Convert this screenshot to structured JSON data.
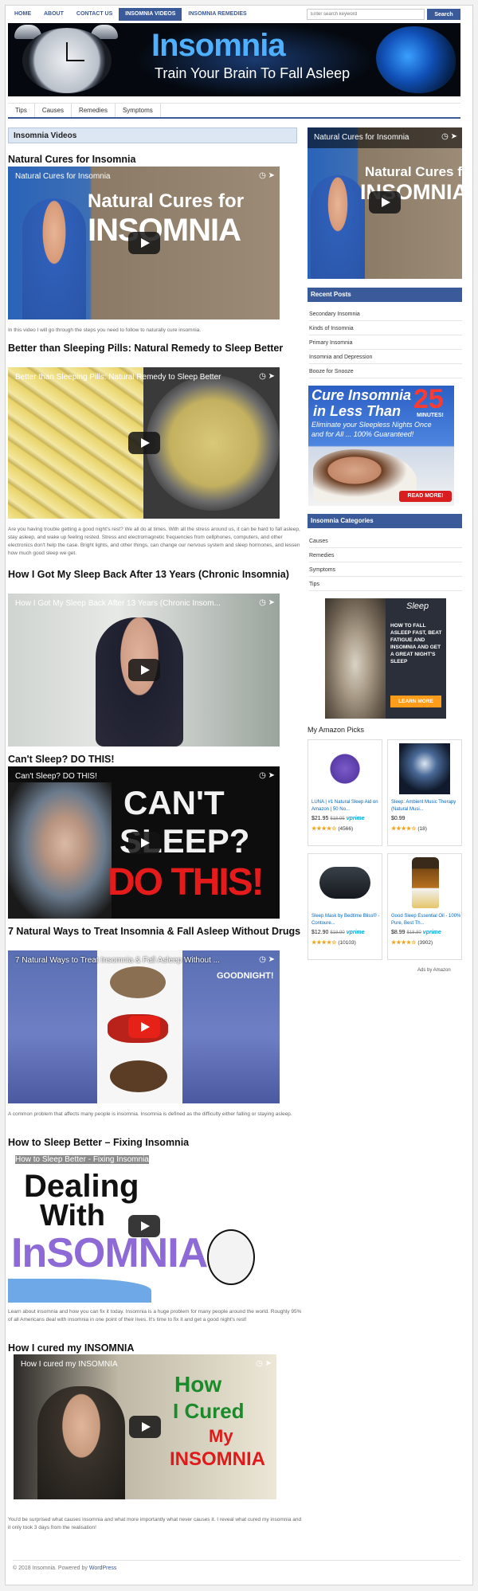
{
  "topnav": {
    "items": [
      "HOME",
      "ABOUT",
      "CONTACT US",
      "INSOMNIA VIDEOS",
      "INSOMNIA REMEDIES"
    ],
    "search_placeholder": "Enter search keyword",
    "search_button": "Search"
  },
  "header": {
    "title": "Insomnia",
    "tagline": "Train Your Brain To Fall Asleep"
  },
  "subnav": {
    "items": [
      "Tips",
      "Causes",
      "Remedies",
      "Symptoms"
    ]
  },
  "main": {
    "box_title": "Insomnia Videos",
    "posts": [
      {
        "title": "Natural Cures for Insomnia",
        "video_title": "Natural Cures for Insomnia",
        "art_line1": "Natural Cures for",
        "art_line2": "INSOMNIA",
        "text": "In this video I will go through the steps you need to follow to naturally cure insomnia."
      },
      {
        "title": "Better than Sleeping Pills: Natural Remedy to Sleep Better",
        "video_title": "Better than Sleeping Pills: Natural Remedy to Sleep Better",
        "text": "Are you having trouble getting a good night's rest? We all do at times. With all the stress around us, it can be hard to fall asleep, stay asleep, and wake up feeling rested. Stress and electromagnetic frequencies from cellphones, computers, and other electronics don't help the case. Bright lights, and other things, can change our nervous system and sleep hormones, and lessen how much good sleep we get."
      },
      {
        "title": "How I Got My Sleep Back After 13 Years (Chronic Insomnia)",
        "video_title": "How I Got My Sleep Back After 13 Years (Chronic Insom..."
      },
      {
        "title": "Can't Sleep? DO THIS!",
        "video_title": "Can't Sleep? DO THIS!",
        "art_line1": "CAN'T",
        "art_line2": "SLEEP?",
        "art_line3": "DO THIS!"
      },
      {
        "title": "7 Natural Ways to Treat Insomnia & Fall Asleep Without Drugs",
        "video_title": "7 Natural Ways to Treat Insomnia & Fall Asleep Without ...",
        "art_line1": "GOODNIGHT!",
        "text": "A common problem that affects many people is insomnia. Insomnia is defined as the difficulty either falling or staying asleep."
      },
      {
        "title": "How to Sleep Better – Fixing Insomnia",
        "video_title": "How to Sleep Better - Fixing Insomnia",
        "art_line1": "Dealing",
        "art_line2": "With",
        "art_line3": "InSOMNIA",
        "text": "Learn about insomnia and how you can fix it today. Insomnia is a huge problem for many people around the world. Roughly 95% of all Americans deal with insomnia in one point of their lives. It's time to fix it and get a good night's rest!"
      },
      {
        "title": "How I cured my INSOMNIA",
        "video_title": "How I cured my INSOMNIA",
        "art_line1": "How",
        "art_line2": "I Cured",
        "art_line3": "My",
        "art_line4": "INSOMNIA",
        "text": "You'd be surprised what causes insomnia and what more importantly what never causes it. I reveal what cured my insomnia and it only took 3 days from the realisation!"
      }
    ]
  },
  "sidebar": {
    "video_title": "Natural Cures for Insomnia",
    "video_art_line1": "Natural Cures fo",
    "video_art_line2": "INSOMNIA",
    "recent_posts_title": "Recent Posts",
    "recent_posts": [
      "Secondary Insomnia",
      "Kinds of Insomnia",
      "Primary Insomnia",
      "Insomnia and Depression",
      "Booze for Snooze"
    ],
    "ad1": {
      "line1": "Cure Insomnia",
      "line2": "in Less Than",
      "big": "25",
      "minutes": "MINUTES!",
      "line3": "Eliminate your Sleepless Nights Once",
      "line4": "and for All ... 100% Guaranteed!",
      "button": "READ MORE!"
    },
    "categories_title": "Insomnia Categories",
    "categories": [
      "Causes",
      "Remedies",
      "Symptoms",
      "Tips"
    ],
    "ad2": {
      "brand": "Sleep",
      "text": "HOW TO FALL ASLEEP FAST, BEAT FATIGUE AND INSOMNIA AND GET A GREAT NIGHT'S SLEEP",
      "button": "LEARN MORE"
    },
    "amazon_title": "My Amazon Picks",
    "products": [
      {
        "name": "LUNA | #1 Natural Sleep Aid on Amazon | 50 No...",
        "price": "$21.95",
        "old": "$18.95",
        "prime": "vprime",
        "stars": "★★★★☆",
        "reviews": "(4566)",
        "label": "LUNA"
      },
      {
        "name": "Sleep: Ambient Music Therapy (Natural Musi...",
        "price": "$0.99",
        "old": "",
        "prime": "",
        "stars": "★★★★☆",
        "reviews": "(18)",
        "label": "Sleep"
      },
      {
        "name": "Sleep Mask by Bedtime Bliss® - Contoure...",
        "price": "$12.90",
        "old": "$18.90",
        "prime": "vprime",
        "stars": "★★★★☆",
        "reviews": "(10103)",
        "label": ""
      },
      {
        "name": "Good Sleep Essential Oil - 100% Pure, Best Th...",
        "price": "$8.99",
        "old": "$18.80",
        "prime": "vprime",
        "stars": "★★★★☆",
        "reviews": "(3902)",
        "label": ""
      }
    ],
    "ads_by": "Ads by Amazon"
  },
  "footer": {
    "text": "© 2018 Insomnia. Powered by",
    "link": "WordPress"
  }
}
